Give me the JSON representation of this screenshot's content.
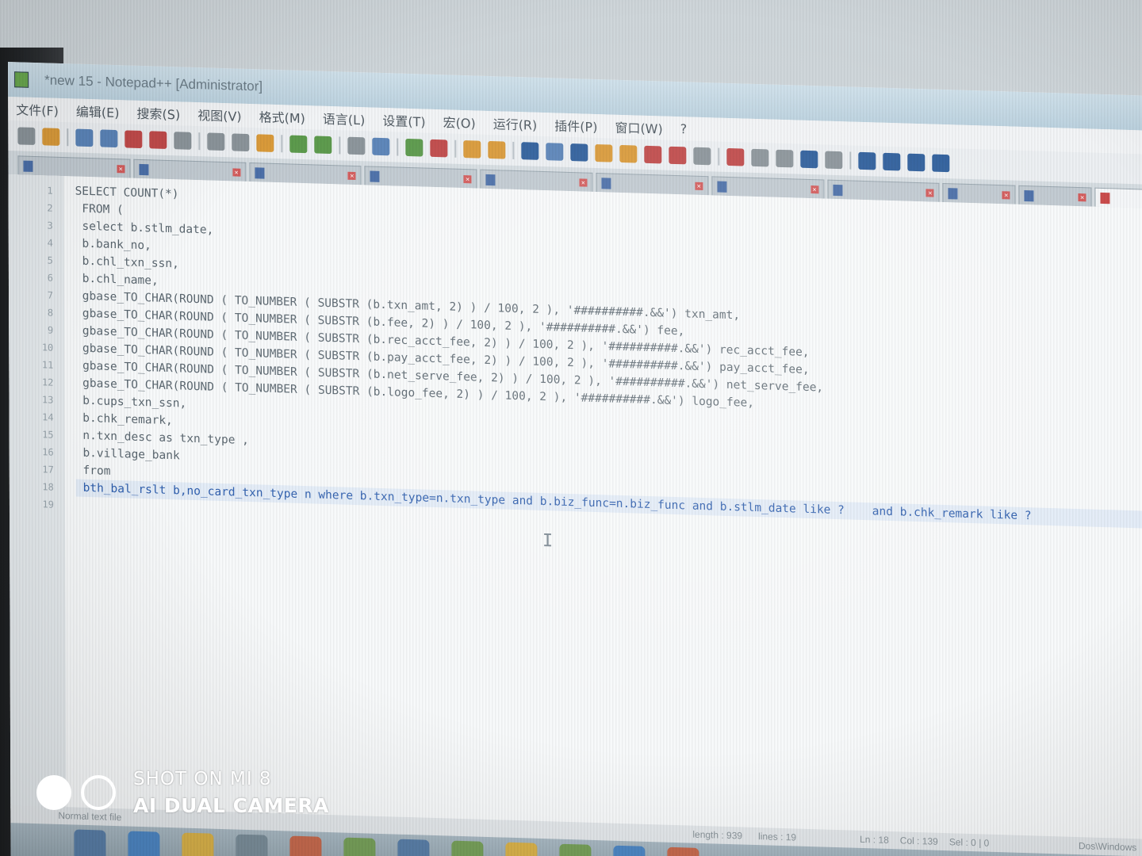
{
  "window": {
    "title": "*new 15 - Notepad++ [Administrator]"
  },
  "menu": {
    "items": [
      "文件(F)",
      "编辑(E)",
      "搜索(S)",
      "视图(V)",
      "格式(M)",
      "语言(L)",
      "设置(T)",
      "宏(O)",
      "运行(R)",
      "插件(P)",
      "窗口(W)",
      "?"
    ]
  },
  "toolbar": {
    "buttons": [
      {
        "icon": "new-file-icon",
        "color": "grey"
      },
      {
        "icon": "open-file-icon",
        "color": "orange"
      },
      {
        "icon": "save-icon",
        "color": "blue"
      },
      {
        "icon": "save-all-icon",
        "color": "blue"
      },
      {
        "icon": "close-icon",
        "color": "red"
      },
      {
        "icon": "close-all-icon",
        "color": "red"
      },
      {
        "icon": "print-icon",
        "color": "grey"
      },
      {
        "icon": "cut-icon",
        "color": "grey"
      },
      {
        "icon": "copy-icon",
        "color": "grey"
      },
      {
        "icon": "paste-icon",
        "color": "orange"
      },
      {
        "icon": "undo-icon",
        "color": "green"
      },
      {
        "icon": "redo-icon",
        "color": "green"
      },
      {
        "icon": "find-icon",
        "color": "grey"
      },
      {
        "icon": "replace-icon",
        "color": "blue"
      },
      {
        "icon": "zoom-in-icon",
        "color": "green"
      },
      {
        "icon": "zoom-out-icon",
        "color": "red"
      },
      {
        "icon": "sync-vertical-icon",
        "color": "orange"
      },
      {
        "icon": "sync-horizontal-icon",
        "color": "orange"
      },
      {
        "icon": "word-wrap-icon",
        "color": "navy"
      },
      {
        "icon": "show-all-chars-icon",
        "color": "blue"
      },
      {
        "icon": "indent-guide-icon",
        "color": "navy"
      },
      {
        "icon": "language-icon",
        "color": "orange"
      },
      {
        "icon": "doc-map-icon",
        "color": "orange"
      },
      {
        "icon": "function-list-icon",
        "color": "red"
      },
      {
        "icon": "folder-workspace-icon",
        "color": "red"
      },
      {
        "icon": "monitoring-icon",
        "color": "grey"
      },
      {
        "icon": "record-macro-icon",
        "color": "red"
      },
      {
        "icon": "stop-macro-icon",
        "color": "grey"
      },
      {
        "icon": "play-macro-icon",
        "color": "grey"
      },
      {
        "icon": "run-macro-multiple-icon",
        "color": "navy"
      },
      {
        "icon": "save-macro-icon",
        "color": "grey"
      },
      {
        "icon": "first-icon",
        "color": "navy"
      },
      {
        "icon": "up-icon",
        "color": "navy"
      },
      {
        "icon": "down-icon",
        "color": "navy"
      },
      {
        "icon": "last-icon",
        "color": "navy"
      }
    ]
  },
  "tabs": [
    {
      "label": "",
      "size": "normal"
    },
    {
      "label": "",
      "size": "normal"
    },
    {
      "label": "",
      "size": "normal"
    },
    {
      "label": "",
      "size": "normal"
    },
    {
      "label": "",
      "size": "normal"
    },
    {
      "label": "",
      "size": "normal"
    },
    {
      "label": "",
      "size": "normal"
    },
    {
      "label": "",
      "size": "normal"
    },
    {
      "label": "",
      "size": "small"
    },
    {
      "label": "",
      "size": "small"
    },
    {
      "label": "",
      "size": "active"
    }
  ],
  "editor": {
    "lines": [
      "SELECT COUNT(*)",
      " FROM (",
      " select b.stlm_date,",
      " b.bank_no,",
      " b.chl_txn_ssn,",
      " b.chl_name,",
      " gbase_TO_CHAR(ROUND ( TO_NUMBER ( SUBSTR (b.txn_amt, 2) ) / 100, 2 ), '##########.&&') txn_amt,",
      " gbase_TO_CHAR(ROUND ( TO_NUMBER ( SUBSTR (b.fee, 2) ) / 100, 2 ), '##########.&&') fee,",
      " gbase_TO_CHAR(ROUND ( TO_NUMBER ( SUBSTR (b.rec_acct_fee, 2) ) / 100, 2 ), '##########.&&') rec_acct_fee,",
      " gbase_TO_CHAR(ROUND ( TO_NUMBER ( SUBSTR (b.pay_acct_fee, 2) ) / 100, 2 ), '##########.&&') pay_acct_fee,",
      " gbase_TO_CHAR(ROUND ( TO_NUMBER ( SUBSTR (b.net_serve_fee, 2) ) / 100, 2 ), '##########.&&') net_serve_fee,",
      " gbase_TO_CHAR(ROUND ( TO_NUMBER ( SUBSTR (b.logo_fee, 2) ) / 100, 2 ), '##########.&&') logo_fee,",
      " b.cups_txn_ssn,",
      " b.chk_remark,",
      " n.txn_desc as txn_type ,",
      " b.village_bank",
      " from",
      " bth_bal_rslt b,no_card_txn_type n where b.txn_type=n.txn_type and b.biz_func=n.biz_func and b.stlm_date like ?    and b.chk_remark like ?",
      ""
    ],
    "current_line": 18
  },
  "status": {
    "mode": "Normal text file",
    "length": "length : 939",
    "lines": "lines : 19",
    "ln": "Ln : 18",
    "col": "Col : 139",
    "sel": "Sel : 0 | 0",
    "end": "Dos\\Windows"
  },
  "watermark": {
    "line1": "SHOT ON MI 8",
    "line2": "AI DUAL CAMERA"
  }
}
